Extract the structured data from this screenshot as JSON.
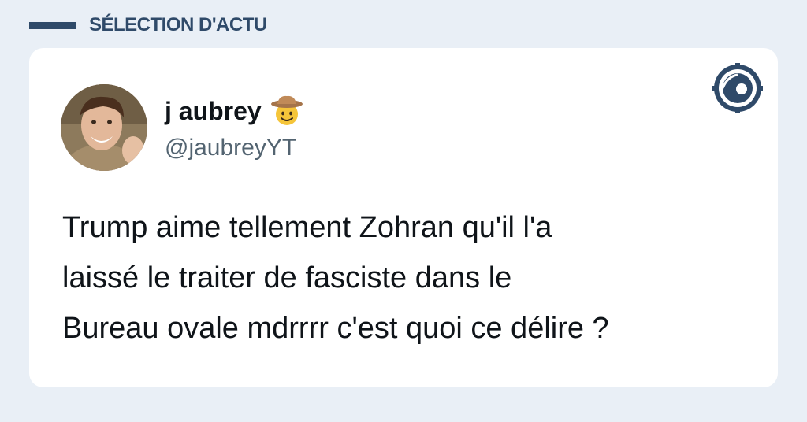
{
  "section": {
    "title": "SÉLECTION D'ACTU"
  },
  "tweet": {
    "author_name": "j aubrey",
    "author_badge_icon": "cowboy-emoji",
    "author_handle": "@jaubreyYT",
    "text": "Trump aime tellement Zohran qu'il l'a\nlaissé le traiter de fasciste dans le\nBureau ovale mdrrrr c'est quoi ce délire ?"
  },
  "brand": {
    "logo_icon": "brand-logo-icon"
  },
  "colors": {
    "background": "#e9eff6",
    "accent": "#2f4a69",
    "card": "#ffffff",
    "text": "#0f1419",
    "muted": "#536471"
  }
}
